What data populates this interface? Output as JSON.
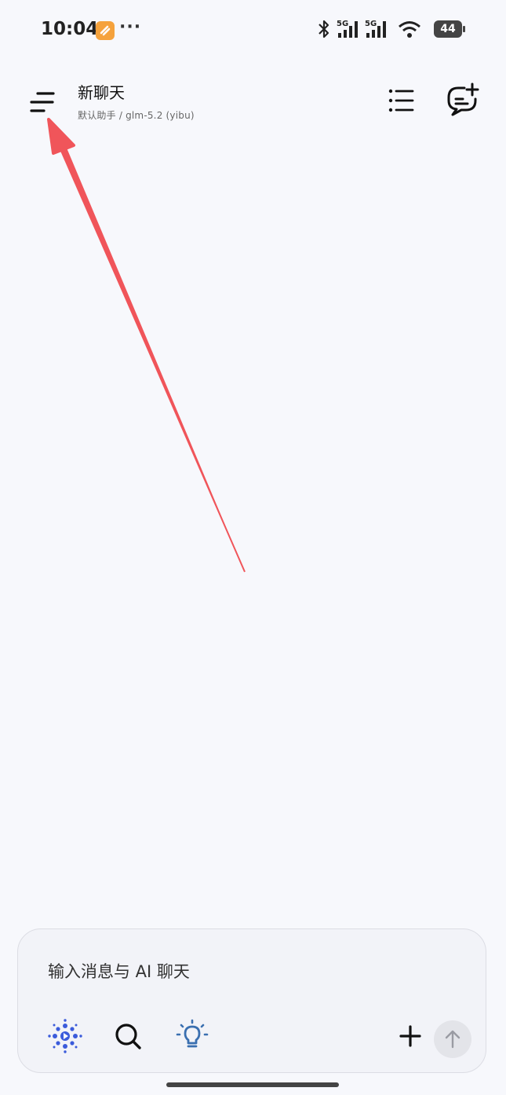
{
  "status_bar": {
    "time": "10:04",
    "overflow_dots": "···",
    "network_1": "5G",
    "network_2": "5G",
    "battery": "44",
    "icons": [
      "app-badge-icon",
      "bluetooth-icon",
      "signal-icon",
      "wifi-icon",
      "battery-icon"
    ]
  },
  "header": {
    "title": "新聊天",
    "subtitle": "默认助手 / glm-5.2 (yibu)",
    "icons": {
      "menu": "menu-icon",
      "list": "list-icon",
      "new_chat": "new-chat-icon"
    }
  },
  "composer": {
    "placeholder": "输入消息与 AI 聊天",
    "tools": [
      "model-icon",
      "search-icon",
      "lightbulb-icon",
      "plus-icon",
      "send-arrow-icon"
    ]
  },
  "colors": {
    "background": "#f7f8fc",
    "annotation_arrow": "#f0555a",
    "accent_blue": "#3b5bdb",
    "bulb_blue": "#3a6fb0"
  }
}
